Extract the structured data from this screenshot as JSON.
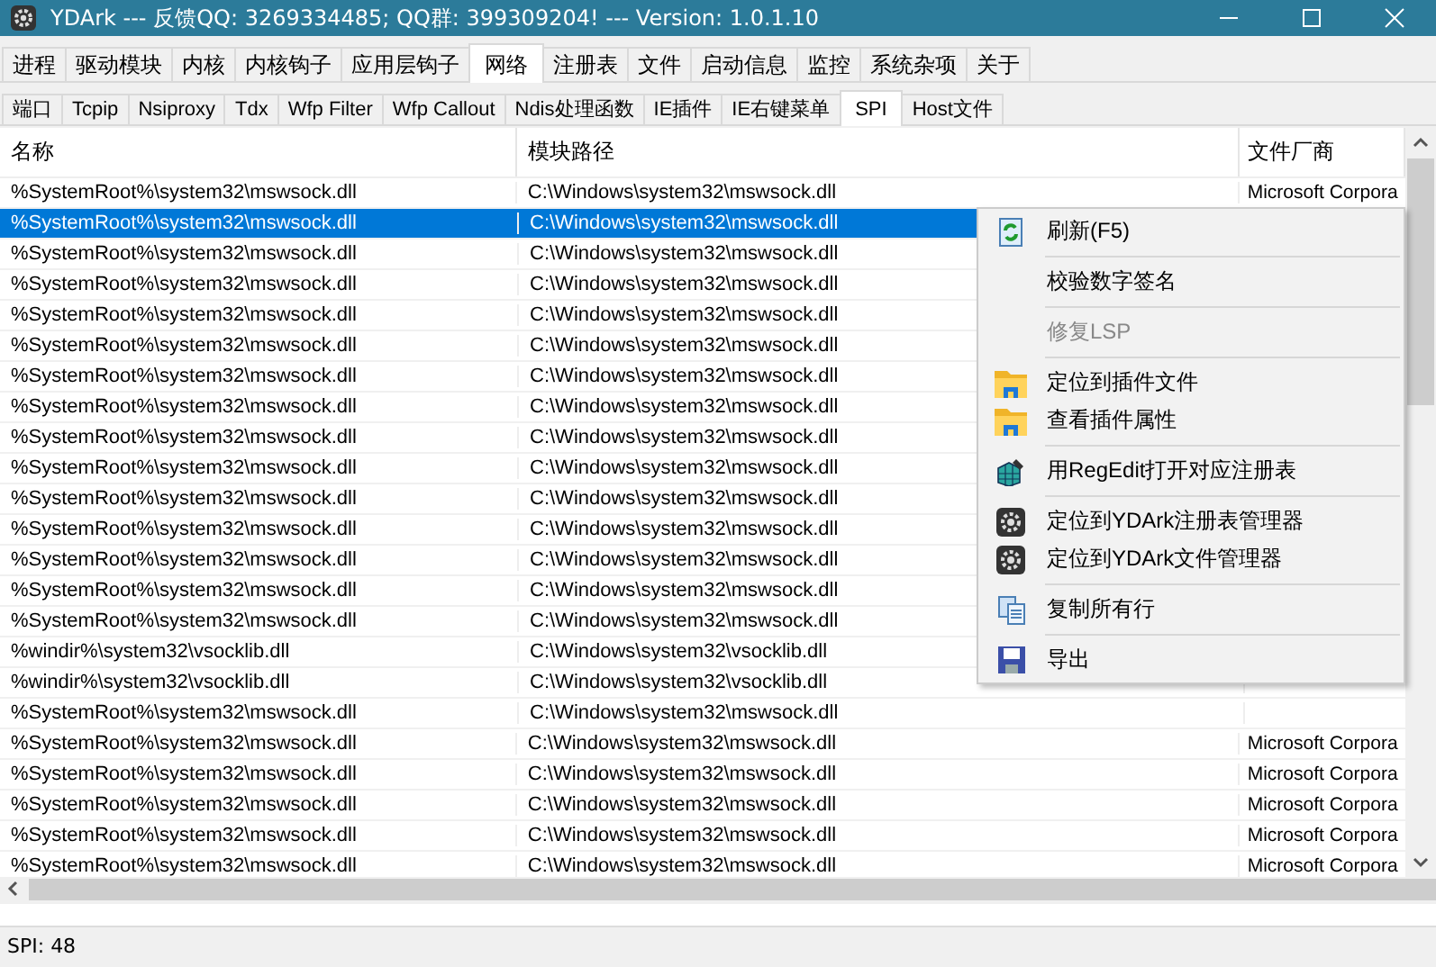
{
  "window": {
    "title": "YDArk --- 反馈QQ: 3269334485; QQ群: 399309204! --- Version: 1.0.1.10"
  },
  "main_tabs": [
    {
      "label": "进程",
      "selected": false
    },
    {
      "label": "驱动模块",
      "selected": false
    },
    {
      "label": "内核",
      "selected": false
    },
    {
      "label": "内核钩子",
      "selected": false
    },
    {
      "label": "应用层钩子",
      "selected": false
    },
    {
      "label": "网络",
      "selected": true
    },
    {
      "label": "注册表",
      "selected": false
    },
    {
      "label": "文件",
      "selected": false
    },
    {
      "label": "启动信息",
      "selected": false
    },
    {
      "label": "监控",
      "selected": false
    },
    {
      "label": "系统杂项",
      "selected": false
    },
    {
      "label": "关于",
      "selected": false
    }
  ],
  "sub_tabs": [
    {
      "label": "端口",
      "selected": false
    },
    {
      "label": "Tcpip",
      "selected": false
    },
    {
      "label": "Nsiproxy",
      "selected": false
    },
    {
      "label": "Tdx",
      "selected": false
    },
    {
      "label": "Wfp Filter",
      "selected": false
    },
    {
      "label": "Wfp Callout",
      "selected": false
    },
    {
      "label": "Ndis处理函数",
      "selected": false
    },
    {
      "label": "IE插件",
      "selected": false
    },
    {
      "label": "IE右键菜单",
      "selected": false
    },
    {
      "label": "SPI",
      "selected": true
    },
    {
      "label": "Host文件",
      "selected": false
    }
  ],
  "table": {
    "columns": [
      "名称",
      "模块路径",
      "文件厂商"
    ],
    "rows": [
      {
        "name": "%SystemRoot%\\system32\\mswsock.dll",
        "path": "C:\\Windows\\system32\\mswsock.dll",
        "vendor": "Microsoft Corpora",
        "selected": false
      },
      {
        "name": "%SystemRoot%\\system32\\mswsock.dll",
        "path": "C:\\Windows\\system32\\mswsock.dll",
        "selected": true
      },
      {
        "name": "%SystemRoot%\\system32\\mswsock.dll",
        "path": "C:\\Windows\\system32\\mswsock.dll",
        "selected": false
      },
      {
        "name": "%SystemRoot%\\system32\\mswsock.dll",
        "path": "C:\\Windows\\system32\\mswsock.dll",
        "selected": false
      },
      {
        "name": "%SystemRoot%\\system32\\mswsock.dll",
        "path": "C:\\Windows\\system32\\mswsock.dll",
        "selected": false
      },
      {
        "name": "%SystemRoot%\\system32\\mswsock.dll",
        "path": "C:\\Windows\\system32\\mswsock.dll",
        "selected": false
      },
      {
        "name": "%SystemRoot%\\system32\\mswsock.dll",
        "path": "C:\\Windows\\system32\\mswsock.dll",
        "selected": false
      },
      {
        "name": "%SystemRoot%\\system32\\mswsock.dll",
        "path": "C:\\Windows\\system32\\mswsock.dll",
        "selected": false
      },
      {
        "name": "%SystemRoot%\\system32\\mswsock.dll",
        "path": "C:\\Windows\\system32\\mswsock.dll",
        "selected": false
      },
      {
        "name": "%SystemRoot%\\system32\\mswsock.dll",
        "path": "C:\\Windows\\system32\\mswsock.dll",
        "selected": false
      },
      {
        "name": "%SystemRoot%\\system32\\mswsock.dll",
        "path": "C:\\Windows\\system32\\mswsock.dll",
        "selected": false
      },
      {
        "name": "%SystemRoot%\\system32\\mswsock.dll",
        "path": "C:\\Windows\\system32\\mswsock.dll",
        "selected": false
      },
      {
        "name": "%SystemRoot%\\system32\\mswsock.dll",
        "path": "C:\\Windows\\system32\\mswsock.dll",
        "selected": false
      },
      {
        "name": "%SystemRoot%\\system32\\mswsock.dll",
        "path": "C:\\Windows\\system32\\mswsock.dll",
        "selected": false
      },
      {
        "name": "%SystemRoot%\\system32\\mswsock.dll",
        "path": "C:\\Windows\\system32\\mswsock.dll",
        "selected": false
      },
      {
        "name": "%windir%\\system32\\vsocklib.dll",
        "path": "C:\\Windows\\system32\\vsocklib.dll",
        "selected": false
      },
      {
        "name": "%windir%\\system32\\vsocklib.dll",
        "path": "C:\\Windows\\system32\\vsocklib.dll",
        "selected": false
      },
      {
        "name": "%SystemRoot%\\system32\\mswsock.dll",
        "path": "C:\\Windows\\system32\\mswsock.dll",
        "selected": false
      },
      {
        "name": "%SystemRoot%\\system32\\mswsock.dll",
        "path": "C:\\Windows\\system32\\mswsock.dll",
        "vendor": "Microsoft Corpora",
        "selected": false
      },
      {
        "name": "%SystemRoot%\\system32\\mswsock.dll",
        "path": "C:\\Windows\\system32\\mswsock.dll",
        "vendor": "Microsoft Corpora",
        "selected": false
      },
      {
        "name": "%SystemRoot%\\system32\\mswsock.dll",
        "path": "C:\\Windows\\system32\\mswsock.dll",
        "vendor": "Microsoft Corpora",
        "selected": false
      },
      {
        "name": "%SystemRoot%\\system32\\mswsock.dll",
        "path": "C:\\Windows\\system32\\mswsock.dll",
        "vendor": "Microsoft Corpora",
        "selected": false
      },
      {
        "name": "%SystemRoot%\\system32\\mswsock.dll",
        "path": "C:\\Windows\\system32\\mswsock.dll",
        "vendor": "Microsoft Corpora",
        "selected": false
      }
    ]
  },
  "context_menu": [
    {
      "label": "刷新(F5)",
      "kind": "refresh",
      "disabled": false,
      "separator_after": true
    },
    {
      "label": "校验数字签名",
      "kind": "none",
      "disabled": false,
      "separator_after": true
    },
    {
      "label": "修复LSP",
      "kind": "none",
      "disabled": true,
      "separator_after": true
    },
    {
      "label": "定位到插件文件",
      "kind": "folder",
      "disabled": false,
      "separator_after": false
    },
    {
      "label": "查看插件属性",
      "kind": "folder",
      "disabled": false,
      "separator_after": true
    },
    {
      "label": "用RegEdit打开对应注册表",
      "kind": "regedit",
      "disabled": false,
      "separator_after": true
    },
    {
      "label": "定位到YDArk注册表管理器",
      "kind": "gear",
      "disabled": false,
      "separator_after": false
    },
    {
      "label": "定位到YDArk文件管理器",
      "kind": "gear",
      "disabled": false,
      "separator_after": true
    },
    {
      "label": "复制所有行",
      "kind": "copy",
      "disabled": false,
      "separator_after": true
    },
    {
      "label": "导出",
      "kind": "save",
      "disabled": false,
      "separator_after": false
    }
  ],
  "status_bar": "SPI: 48"
}
